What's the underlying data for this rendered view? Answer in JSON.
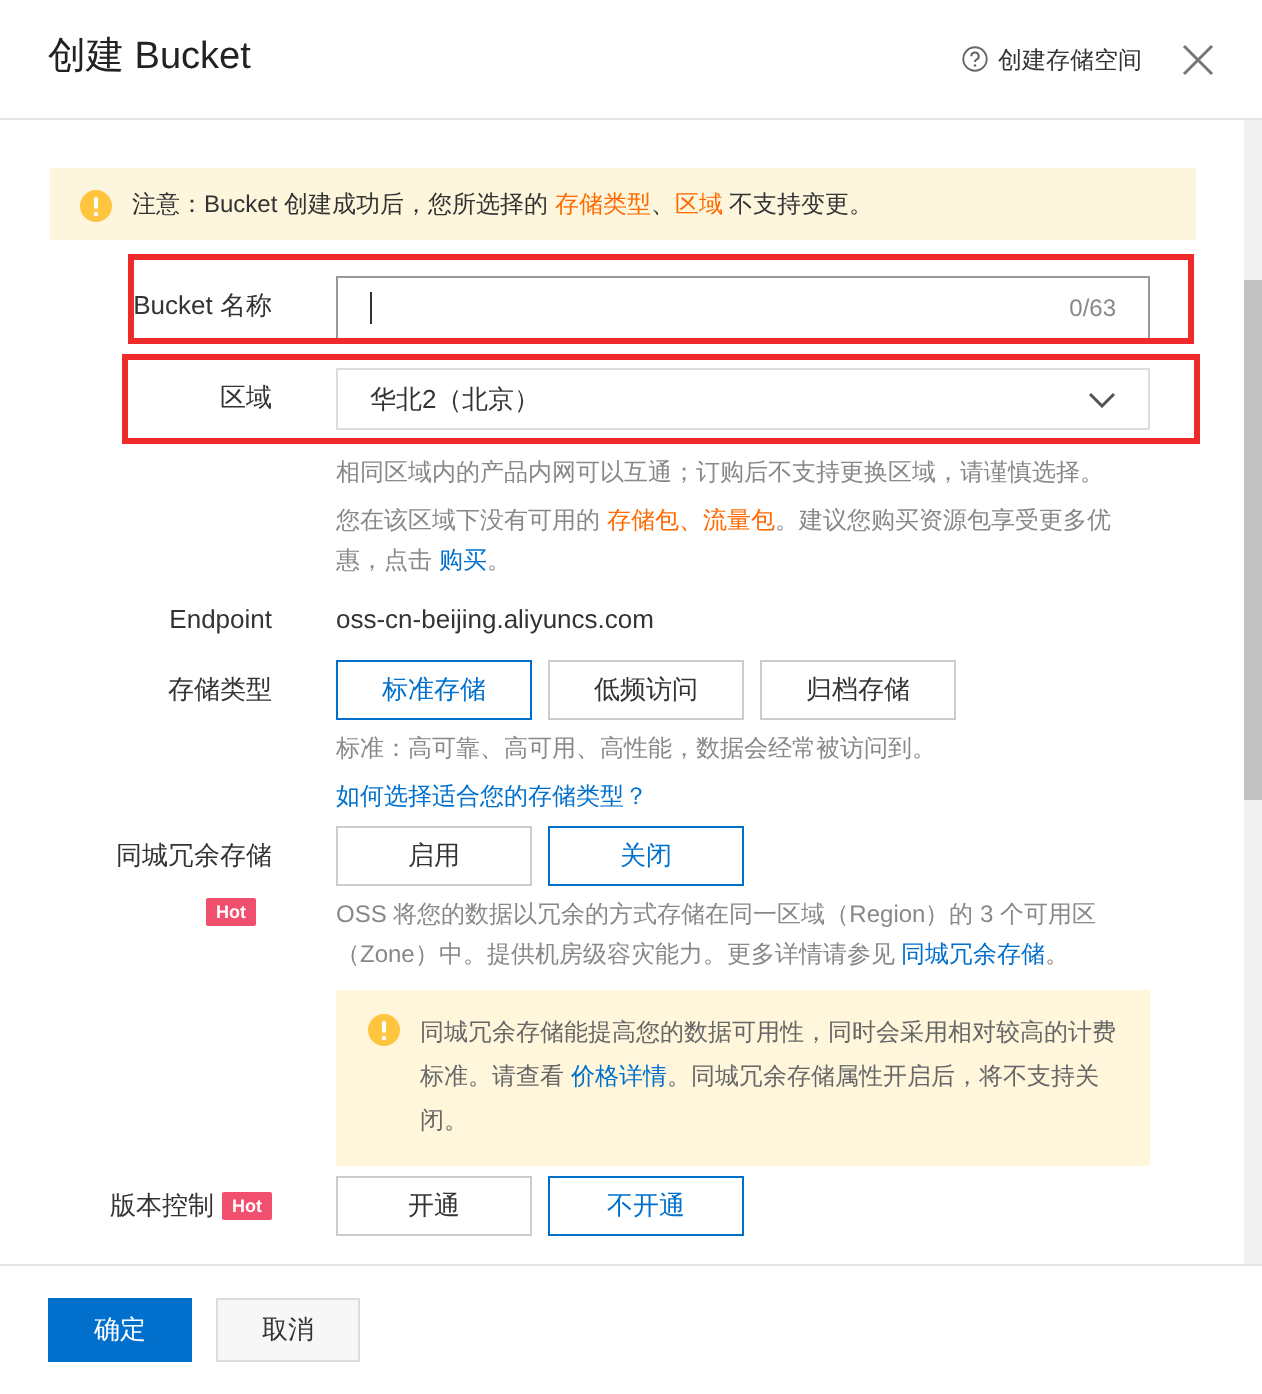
{
  "dialog": {
    "title": "创建 Bucket",
    "help_link": "创建存储空间"
  },
  "notice": [
    {
      "text": "注意：Bucket 创建成功后，您所选择的 ",
      "kind": "plain"
    },
    {
      "text": "存储类型",
      "kind": "accent"
    },
    {
      "text": "、",
      "kind": "plain"
    },
    {
      "text": "区域",
      "kind": "accent"
    },
    {
      "text": " 不支持变更。",
      "kind": "plain"
    }
  ],
  "fields": [
    {
      "kind": "text_input",
      "label": "Bucket 名称",
      "counter": "0/63",
      "highlighted": true
    },
    {
      "kind": "select",
      "label": "区域",
      "value": "华北2（北京）",
      "highlighted": true,
      "help": [
        [
          {
            "text": "相同区域内的产品内网可以互通；订购后不支持更换区域，请谨慎选择。",
            "kind": "plain"
          }
        ],
        [
          {
            "text": "您在该区域下没有可用的 ",
            "kind": "plain"
          },
          {
            "text": "存储包",
            "kind": "accent"
          },
          {
            "text": "、",
            "kind": "accent"
          },
          {
            "text": "流量包",
            "kind": "accent"
          },
          {
            "text": "。建议您购买资源包享受更多优惠，点击 ",
            "kind": "plain"
          },
          {
            "text": "购买",
            "kind": "link"
          },
          {
            "text": "。",
            "kind": "plain"
          }
        ]
      ]
    },
    {
      "kind": "static",
      "label": "Endpoint",
      "value": "oss-cn-beijing.aliyuncs.com"
    },
    {
      "kind": "options",
      "label": "存储类型",
      "options": [
        {
          "label": "标准存储",
          "selected": true
        },
        {
          "label": "低频访问",
          "selected": false
        },
        {
          "label": "归档存储",
          "selected": false
        }
      ],
      "help": [
        [
          {
            "text": "标准：高可靠、高可用、高性能，数据会经常被访问到。",
            "kind": "plain"
          }
        ],
        [
          {
            "text": "如何选择适合您的存储类型？",
            "kind": "link"
          }
        ]
      ]
    },
    {
      "kind": "options",
      "label": "同城冗余存储",
      "badge": "Hot",
      "options": [
        {
          "label": "启用",
          "selected": false
        },
        {
          "label": "关闭",
          "selected": true
        }
      ],
      "help": [
        [
          {
            "text": "OSS 将您的数据以冗余的方式存储在同一区域（Region）的 3 个可用区（Zone）中。提供机房级容灾能力。更多详情请参见 ",
            "kind": "plain"
          },
          {
            "text": "同城冗余存储",
            "kind": "link"
          },
          {
            "text": "。",
            "kind": "plain"
          }
        ]
      ],
      "warning": [
        {
          "text": "同城冗余存储能提高您的数据可用性，同时会采用相对较高的计费标准。请查看 ",
          "kind": "plain"
        },
        {
          "text": "价格详情",
          "kind": "link"
        },
        {
          "text": "。同城冗余存储属性开启后，将不支持关闭。",
          "kind": "plain"
        }
      ]
    },
    {
      "kind": "options",
      "label": "版本控制",
      "badge": "Hot",
      "options": [
        {
          "label": "开通",
          "selected": false
        },
        {
          "label": "不开通",
          "selected": true
        }
      ]
    }
  ],
  "footer": [
    {
      "label": "确定",
      "kind": "primary"
    },
    {
      "label": "取消",
      "kind": "secondary"
    }
  ]
}
